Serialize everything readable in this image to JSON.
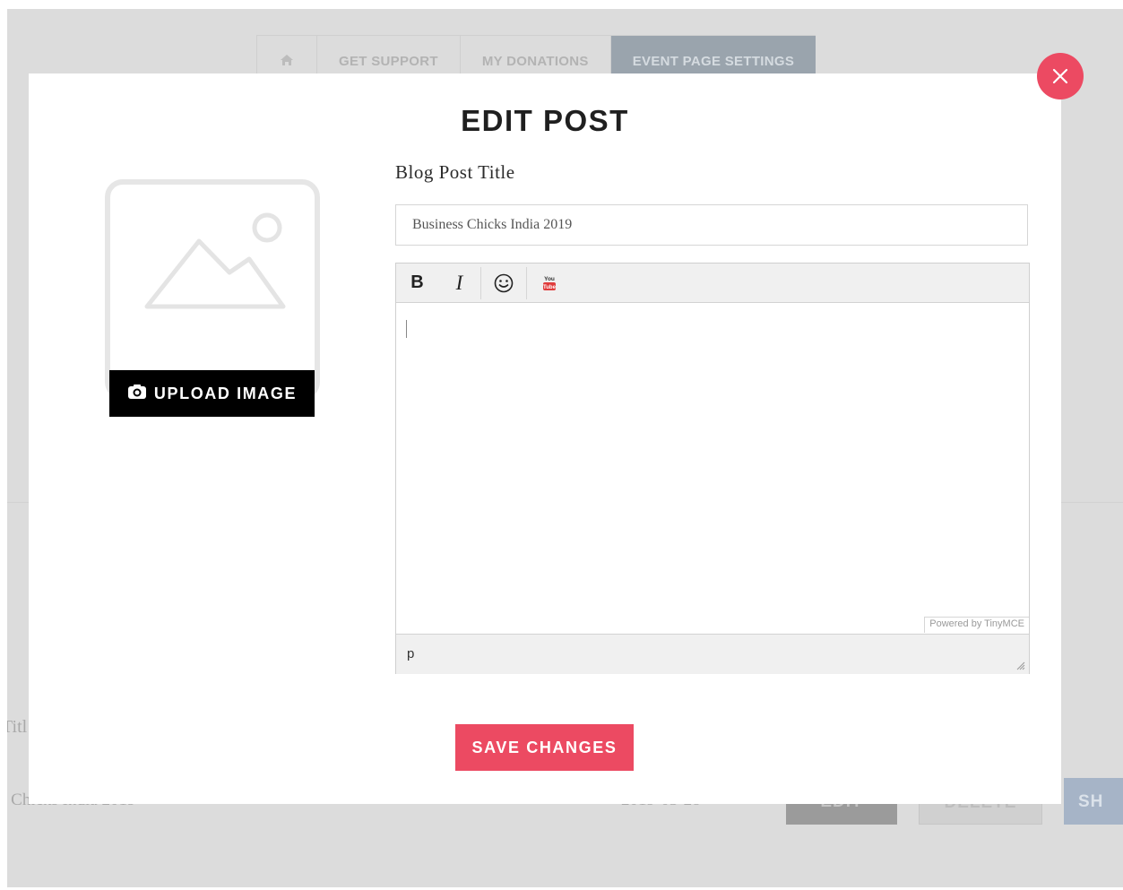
{
  "background": {
    "tabs": [
      {
        "label": "",
        "icon": "home-icon"
      },
      {
        "label": "GET SUPPORT"
      },
      {
        "label": "MY DONATIONS"
      },
      {
        "label": "EVENT PAGE SETTINGS",
        "active": true
      }
    ],
    "column_title_fragment": "Titl",
    "row": {
      "title_fragment": "s Chicks India 2019",
      "date_fragment": "2019-03-28",
      "edit_label": "EDIT",
      "delete_label": "DELETE",
      "share_label": "SH"
    }
  },
  "modal": {
    "title": "EDIT POST",
    "close_icon": "close-icon",
    "upload": {
      "label": "UPLOAD IMAGE",
      "icon": "camera-icon",
      "placeholder_icon": "image-placeholder-icon"
    },
    "form": {
      "title_label": "Blog Post Title",
      "title_value": "Business Chicks India 2019"
    },
    "editor": {
      "toolbar": {
        "bold": "B",
        "italic": "I",
        "emoji_icon": "smiley-icon",
        "youtube_icon": "youtube-icon"
      },
      "powered_by": "Powered by TinyMCE",
      "status_path": "p"
    },
    "save_label": "SAVE CHANGES"
  },
  "colors": {
    "accent": "#ec4a62",
    "overlay": "#dcdcdc",
    "active_tab": "#9aa4ad"
  }
}
